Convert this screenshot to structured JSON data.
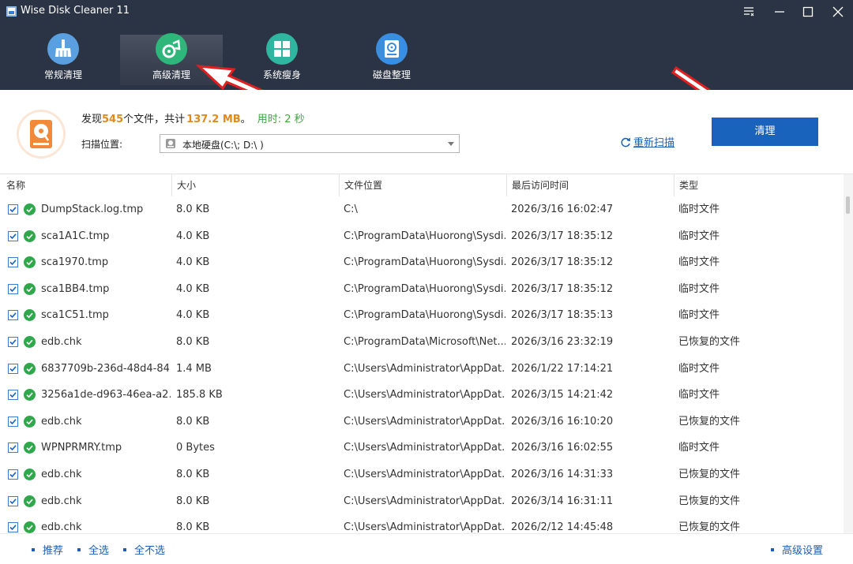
{
  "window": {
    "title": "Wise Disk Cleaner 11",
    "controls": [
      "menu-icon",
      "minimize-icon",
      "maximize-icon",
      "close-icon"
    ]
  },
  "tabs": [
    {
      "label": "常规清理",
      "icon": "broom-icon",
      "active": false
    },
    {
      "label": "高级清理",
      "icon": "advanced-clean-icon",
      "active": true
    },
    {
      "label": "系统瘦身",
      "icon": "windows-icon",
      "active": false
    },
    {
      "label": "磁盘整理",
      "icon": "disk-defrag-icon",
      "active": false
    }
  ],
  "summary": {
    "found_prefix": "发现",
    "file_count": "545",
    "files_text": "个文件，共计",
    "total_size": "137.2 MB",
    "period": "。",
    "elapsed": "用时: 2 秒",
    "scan_location_label": "扫描位置:",
    "scan_location_value": "本地硬盘(C:\\; D:\\ )",
    "rescan_label": "重新扫描",
    "clean_button_label": "清理"
  },
  "table": {
    "columns": [
      "名称",
      "大小",
      "文件位置",
      "最后访问时间",
      "类型"
    ],
    "rows": [
      {
        "name": "DumpStack.log.tmp",
        "size": "8.0 KB",
        "location": "C:\\",
        "accessed": "2026/3/16 16:02:47",
        "type": "临时文件",
        "checked": true
      },
      {
        "name": "sca1A1C.tmp",
        "size": "4.0 KB",
        "location": "C:\\ProgramData\\Huorong\\Sysdi...",
        "accessed": "2026/3/17 18:35:12",
        "type": "临时文件",
        "checked": true
      },
      {
        "name": "sca1970.tmp",
        "size": "4.0 KB",
        "location": "C:\\ProgramData\\Huorong\\Sysdi...",
        "accessed": "2026/3/17 18:35:12",
        "type": "临时文件",
        "checked": true
      },
      {
        "name": "sca1BB4.tmp",
        "size": "4.0 KB",
        "location": "C:\\ProgramData\\Huorong\\Sysdi...",
        "accessed": "2026/3/17 18:35:12",
        "type": "临时文件",
        "checked": true
      },
      {
        "name": "sca1C51.tmp",
        "size": "4.0 KB",
        "location": "C:\\ProgramData\\Huorong\\Sysdi...",
        "accessed": "2026/3/17 18:35:13",
        "type": "临时文件",
        "checked": true
      },
      {
        "name": "edb.chk",
        "size": "8.0 KB",
        "location": "C:\\ProgramData\\Microsoft\\Net...",
        "accessed": "2026/3/16 23:32:19",
        "type": "已恢复的文件",
        "checked": true
      },
      {
        "name": "6837709b-236d-48d4-84...",
        "size": "1.4 MB",
        "location": "C:\\Users\\Administrator\\AppDat...",
        "accessed": "2026/1/22 17:14:21",
        "type": "临时文件",
        "checked": true
      },
      {
        "name": "3256a1de-d963-46ea-a2...",
        "size": "185.8 KB",
        "location": "C:\\Users\\Administrator\\AppDat...",
        "accessed": "2026/3/15 14:21:42",
        "type": "临时文件",
        "checked": true
      },
      {
        "name": "edb.chk",
        "size": "8.0 KB",
        "location": "C:\\Users\\Administrator\\AppDat...",
        "accessed": "2026/3/16 16:10:20",
        "type": "已恢复的文件",
        "checked": true
      },
      {
        "name": "WPNPRMRY.tmp",
        "size": "0 Bytes",
        "location": "C:\\Users\\Administrator\\AppDat...",
        "accessed": "2026/3/16 16:02:55",
        "type": "临时文件",
        "checked": true
      },
      {
        "name": "edb.chk",
        "size": "8.0 KB",
        "location": "C:\\Users\\Administrator\\AppDat...",
        "accessed": "2026/3/16 14:31:33",
        "type": "已恢复的文件",
        "checked": true
      },
      {
        "name": "edb.chk",
        "size": "8.0 KB",
        "location": "C:\\Users\\Administrator\\AppDat...",
        "accessed": "2026/3/14 16:31:11",
        "type": "已恢复的文件",
        "checked": true
      },
      {
        "name": "edb.chk",
        "size": "8.0 KB",
        "location": "C:\\Users\\Administrator\\AppDat...",
        "accessed": "2026/2/12 14:45:48",
        "type": "已恢复的文件",
        "checked": true
      }
    ]
  },
  "footer": {
    "links": [
      "推荐",
      "全选",
      "全不选"
    ],
    "advanced_settings": "高级设置"
  },
  "colors": {
    "topbar_bg": "#2b3444",
    "accent_blue": "#1a63bc",
    "count_orange": "#e08a1a",
    "time_green": "#3da63d",
    "annotation_red": "#e02020"
  }
}
